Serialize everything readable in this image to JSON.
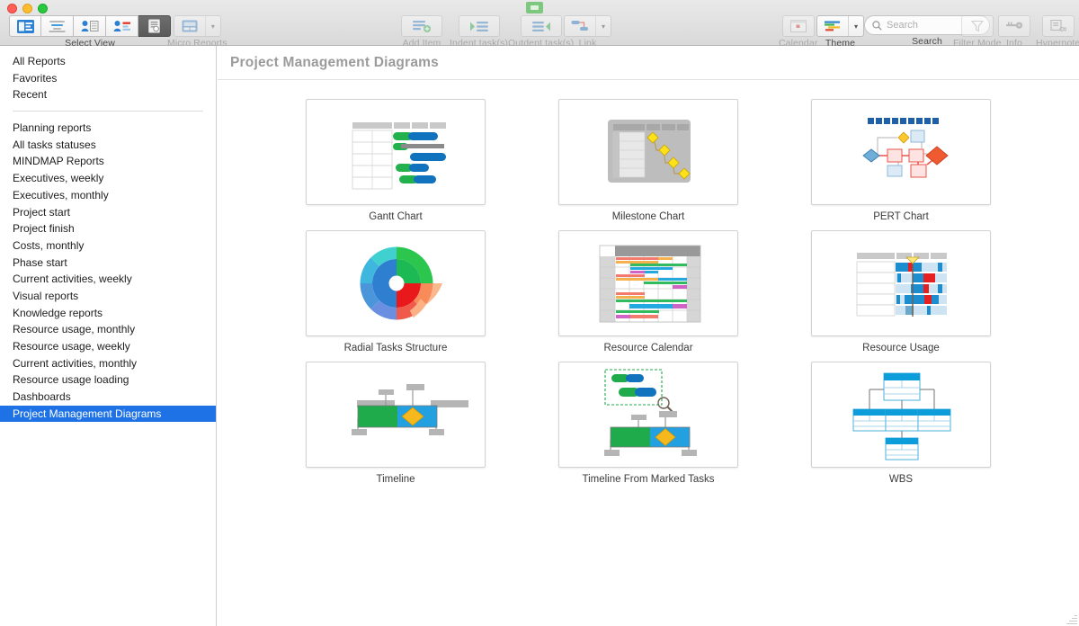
{
  "window": {
    "traffic_lights": [
      "close",
      "minimize",
      "maximize"
    ],
    "colors": {
      "accent_selected": "#1f72e5",
      "gantt_green": "#22b14c",
      "gantt_blue": "#1172bd",
      "milestone_yellow": "#ffe11a",
      "pert_red": "#ef4a2a",
      "pert_blue": "#4a90c8",
      "wbs_blue": "#0d9ddb",
      "title_gray": "#9b9b9b"
    }
  },
  "toolbar": {
    "groups": [
      {
        "id": "select-view",
        "label": "Select View",
        "dim": false
      },
      {
        "id": "micro-reports",
        "label": "Micro Reports",
        "dim": true
      },
      {
        "id": "add-item",
        "label": "Add Item",
        "dim": true
      },
      {
        "id": "indent-tasks",
        "label": "Indent task(s)",
        "dim": true
      },
      {
        "id": "outdent-tasks",
        "label": "Outdent task(s)",
        "dim": true
      },
      {
        "id": "link",
        "label": "Link",
        "dim": true
      },
      {
        "id": "calendar",
        "label": "Calendar",
        "dim": true
      },
      {
        "id": "theme",
        "label": "Theme",
        "dim": false
      },
      {
        "id": "search",
        "label": "Search",
        "dim": false
      },
      {
        "id": "filter-mode",
        "label": "Filter Mode",
        "dim": true
      },
      {
        "id": "info",
        "label": "Info",
        "dim": true
      },
      {
        "id": "hypernote",
        "label": "Hypernote",
        "dim": true
      }
    ],
    "select_view": {
      "label": "Select View"
    },
    "micro_reports": {
      "label": "Micro Reports"
    },
    "add_item": {
      "label": "Add Item"
    },
    "indent_tasks": {
      "label": "Indent task(s)"
    },
    "outdent_tasks": {
      "label": "Outdent task(s)"
    },
    "link": {
      "label": "Link"
    },
    "calendar": {
      "label": "Calendar"
    },
    "theme": {
      "label": "Theme"
    },
    "filter_mode": {
      "label": "Filter Mode"
    },
    "info": {
      "label": "Info"
    },
    "hypernote": {
      "label": "Hypernote"
    }
  },
  "search": {
    "label": "Search",
    "placeholder": "Search",
    "value": ""
  },
  "sidebar": {
    "top_items": [
      {
        "label": "All Reports",
        "selected": false
      },
      {
        "label": "Favorites",
        "selected": false
      },
      {
        "label": "Recent",
        "selected": false
      }
    ],
    "items": [
      {
        "label": "Planning reports",
        "selected": false
      },
      {
        "label": "All tasks statuses",
        "selected": false
      },
      {
        "label": "MINDMAP Reports",
        "selected": false
      },
      {
        "label": "Executives, weekly",
        "selected": false
      },
      {
        "label": "Executives, monthly",
        "selected": false
      },
      {
        "label": "Project start",
        "selected": false
      },
      {
        "label": "Project finish",
        "selected": false
      },
      {
        "label": "Costs, monthly",
        "selected": false
      },
      {
        "label": "Phase start",
        "selected": false
      },
      {
        "label": "Current activities, weekly",
        "selected": false
      },
      {
        "label": "Visual reports",
        "selected": false
      },
      {
        "label": "Knowledge reports",
        "selected": false
      },
      {
        "label": "Resource usage, monthly",
        "selected": false
      },
      {
        "label": "Resource usage, weekly",
        "selected": false
      },
      {
        "label": "Current activities, monthly",
        "selected": false
      },
      {
        "label": "Resource usage loading",
        "selected": false
      },
      {
        "label": "Dashboards",
        "selected": false
      },
      {
        "label": "Project Management Diagrams",
        "selected": true
      }
    ]
  },
  "main": {
    "title": "Project Management Diagrams",
    "cards": [
      {
        "id": "gantt-chart",
        "label": "Gantt Chart"
      },
      {
        "id": "milestone-chart",
        "label": "Milestone Chart"
      },
      {
        "id": "pert-chart",
        "label": "PERT Chart"
      },
      {
        "id": "radial-tasks-structure",
        "label": "Radial Tasks Structure"
      },
      {
        "id": "resource-calendar",
        "label": "Resource Calendar"
      },
      {
        "id": "resource-usage",
        "label": "Resource Usage"
      },
      {
        "id": "timeline",
        "label": "Timeline"
      },
      {
        "id": "timeline-from-marked-tasks",
        "label": "Timeline From Marked Tasks"
      },
      {
        "id": "wbs",
        "label": "WBS"
      }
    ]
  }
}
